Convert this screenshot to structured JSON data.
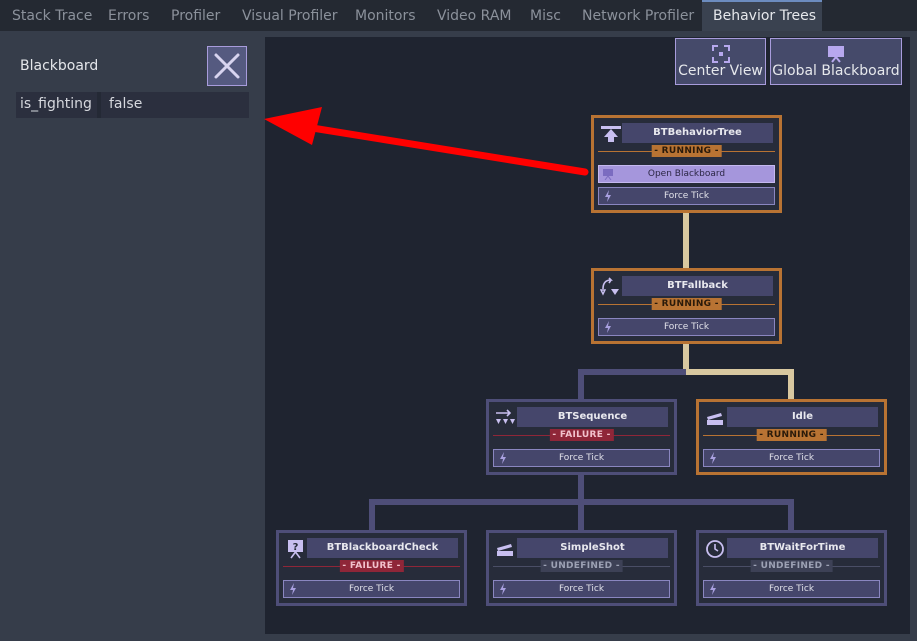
{
  "tabs": [
    "Stack Trace",
    "Errors",
    "Profiler",
    "Visual Profiler",
    "Monitors",
    "Video RAM",
    "Misc",
    "Network Profiler",
    "Behavior Trees"
  ],
  "blackboard": {
    "title": "Blackboard",
    "key": "is_fighting",
    "value": "false"
  },
  "toolbar": {
    "center_view": "Center View",
    "global_blackboard": "Global Blackboard"
  },
  "nodes": {
    "root": {
      "title": "BTBehaviorTree",
      "status": "- RUNNING -",
      "open_label": "Open Blackboard",
      "tick_label": "Force Tick"
    },
    "fallback": {
      "title": "BTFallback",
      "status": "- RUNNING -",
      "tick_label": "Force Tick"
    },
    "sequence": {
      "title": "BTSequence",
      "status": "- FAILURE -",
      "tick_label": "Force Tick"
    },
    "idle": {
      "title": "Idle",
      "status": "- RUNNING -",
      "tick_label": "Force Tick"
    },
    "check": {
      "title": "BTBlackboardCheck",
      "status": "- FAILURE -",
      "tick_label": "Force Tick"
    },
    "shot": {
      "title": "SimpleShot",
      "status": "- UNDEFINED -",
      "tick_label": "Force Tick"
    },
    "wait": {
      "title": "BTWaitForTime",
      "status": "- UNDEFINED -",
      "tick_label": "Force Tick"
    }
  },
  "colors": {
    "running": "#b87333",
    "failure": "#8f2638",
    "idle_edge": "#4e4e78",
    "running_edge": "#d8c8a0",
    "annotation_arrow": "#ff0000"
  }
}
